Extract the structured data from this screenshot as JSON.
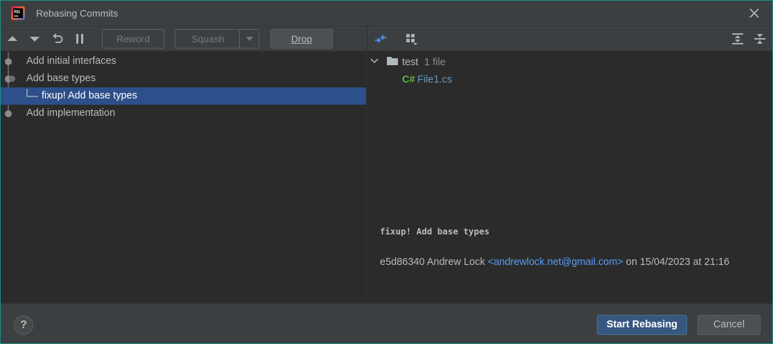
{
  "window": {
    "title": "Rebasing Commits",
    "app_icon": "rider-icon",
    "close_icon": "close-icon"
  },
  "left_toolbar": {
    "icons": [
      "move-up-icon",
      "move-down-icon",
      "undo-icon",
      "pause-icon"
    ],
    "reword_label": "Reword",
    "squash_label": "Squash",
    "drop_label": "Drop"
  },
  "commits": [
    {
      "label": "Add initial interfaces",
      "selected": false,
      "fixup": false
    },
    {
      "label": "Add base types",
      "selected": false,
      "fixup": false
    },
    {
      "label": "fixup! Add base types",
      "selected": true,
      "fixup": true
    },
    {
      "label": "Add implementation",
      "selected": false,
      "fixup": false
    }
  ],
  "right_toolbar": {
    "icons": [
      "diff-icon",
      "group-by-icon",
      "expand-all-icon",
      "collapse-all-icon"
    ]
  },
  "file_tree": {
    "folder_name": "test",
    "folder_count": "1 file",
    "file_lang": "C#",
    "file_name": "File1.cs"
  },
  "details": {
    "message": "fixup! Add base types",
    "hash": "e5d86340",
    "author": "Andrew Lock",
    "email": "<andrewlock.net@gmail.com>",
    "date": "on 15/04/2023 at 21:16"
  },
  "footer": {
    "help_label": "?",
    "start_label": "Start Rebasing",
    "cancel_label": "Cancel"
  },
  "colors": {
    "accent": "#365880",
    "selection": "#2d4f8a",
    "link": "#589df6",
    "file_link": "#6897bb",
    "csharp_green": "#62b543"
  }
}
